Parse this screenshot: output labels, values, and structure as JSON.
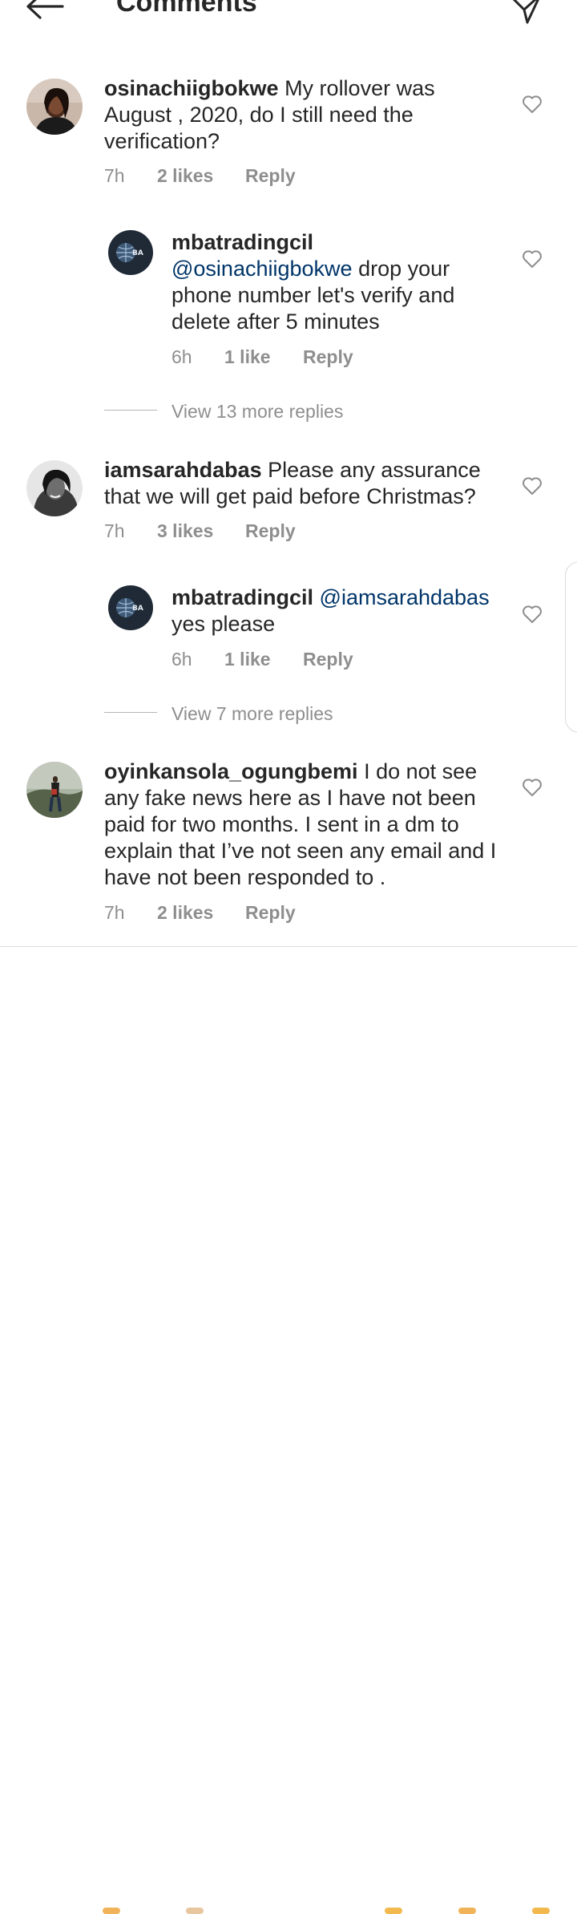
{
  "header": {
    "title": "Comments",
    "back_icon": "arrow-left-icon",
    "send_icon": "paper-plane-icon"
  },
  "colors": {
    "text": "#262626",
    "secondary": "#8e8e8e",
    "mention": "#003569"
  },
  "comments": [
    {
      "username": "osinachiigbokwe",
      "text": "My rollover was August , 2020, do  I still need the verification?",
      "time": "7h",
      "likes": "2 likes",
      "reply": "Reply",
      "icon": "heart-outline-icon"
    },
    {
      "username": "mbatradingcil",
      "mention": "@osinachiigbokwe",
      "text": "drop your phone number let's verify and delete after 5 minutes",
      "time": "6h",
      "likes": "1 like",
      "reply": "Reply",
      "icon": "heart-outline-icon"
    },
    {
      "username": "iamsarahdabas",
      "text": "Please any assurance that we will get paid before Christmas?",
      "time": "7h",
      "likes": "3 likes",
      "reply": "Reply",
      "icon": "heart-outline-icon"
    },
    {
      "username": "mbatradingcil",
      "mention": "@iamsarahdabas",
      "text": "yes please",
      "time": "6h",
      "likes": "1 like",
      "reply": "Reply",
      "icon": "heart-outline-icon"
    },
    {
      "username": "oyinkansola_ogungbemi",
      "text": "I do not see any fake news here as I have not been paid for two months. I sent in a dm to explain that I’ve not seen any email and I have not been responded to .",
      "time": "7h",
      "likes": "2 likes",
      "reply": "Reply",
      "icon": "heart-outline-icon"
    }
  ],
  "view_more": [
    "View 13 more replies",
    "View 7 more replies"
  ]
}
